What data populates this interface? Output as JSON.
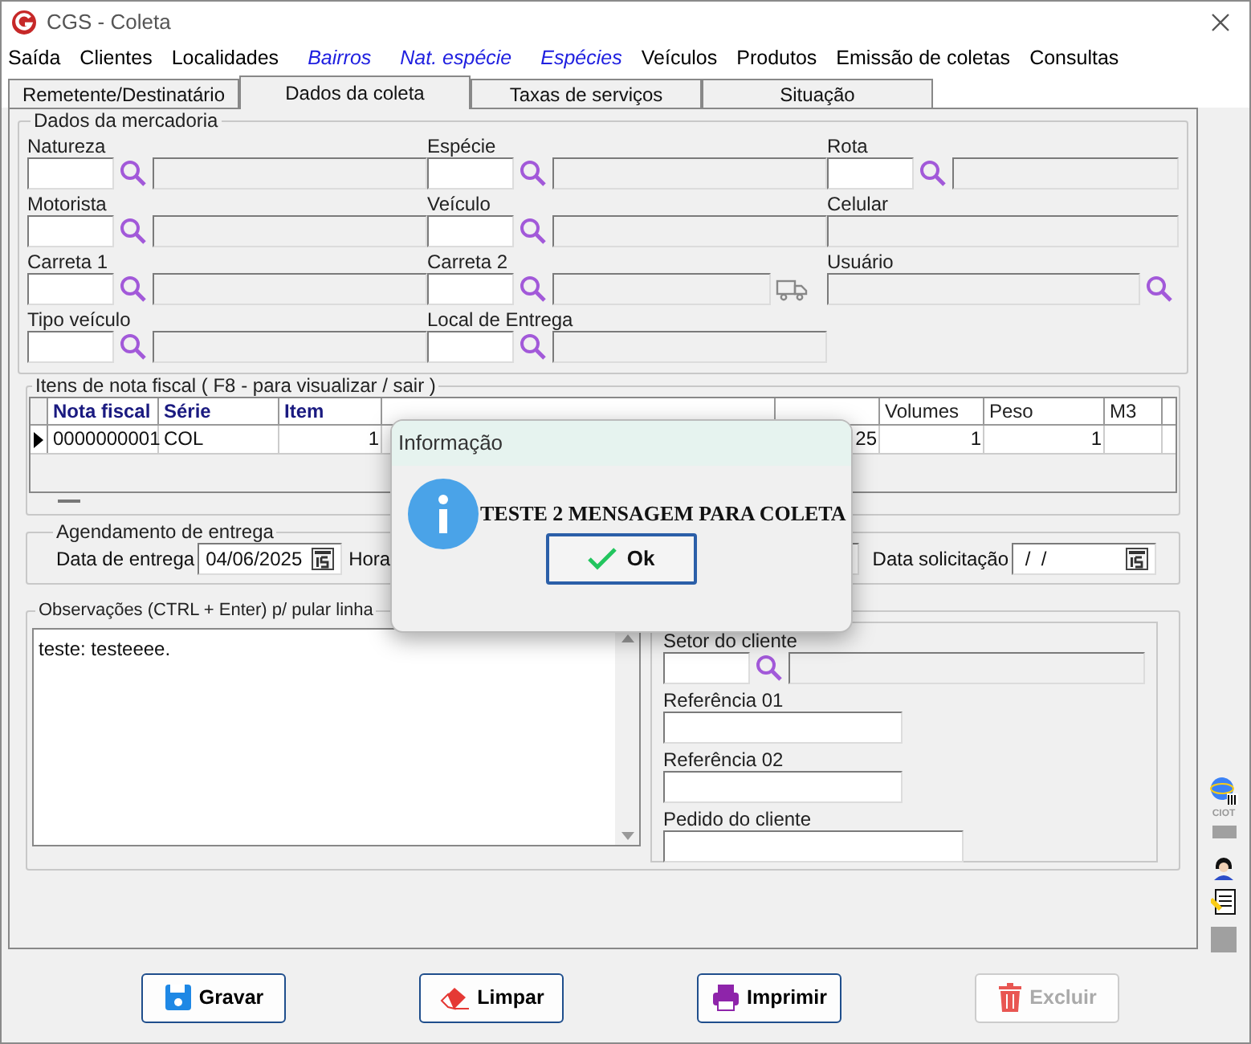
{
  "window": {
    "title": "CGS - Coleta"
  },
  "menu": [
    {
      "label": "Saída",
      "kind": "normal"
    },
    {
      "label": "Clientes",
      "kind": "normal"
    },
    {
      "label": "Localidades",
      "kind": "normal"
    },
    {
      "label": "Bairros",
      "kind": "shortcut"
    },
    {
      "label": "Nat. espécie",
      "kind": "shortcut"
    },
    {
      "label": "Espécies",
      "kind": "shortcut"
    },
    {
      "label": "Veículos",
      "kind": "normal"
    },
    {
      "label": "Produtos",
      "kind": "normal"
    },
    {
      "label": "Emissão de coletas",
      "kind": "normal"
    },
    {
      "label": "Consultas",
      "kind": "normal"
    }
  ],
  "tabs": [
    {
      "label": "Remetente/Destinatário",
      "selected": false
    },
    {
      "label": "Dados da coleta",
      "selected": true
    },
    {
      "label": "Taxas de serviços",
      "selected": false
    },
    {
      "label": "Situação",
      "selected": false
    }
  ],
  "cargo_group": {
    "title": "Dados da mercadoria",
    "rows": [
      [
        {
          "label": "Natureza",
          "kind": "lookup"
        },
        {
          "label": "Espécie",
          "kind": "lookup"
        },
        {
          "label": "Rota",
          "kind": "lookup"
        }
      ],
      [
        {
          "label": "Motorista",
          "kind": "lookup"
        },
        {
          "label": "Veículo",
          "kind": "lookup"
        },
        {
          "label": "Celular",
          "kind": "plain"
        }
      ],
      [
        {
          "label": "Carreta 1",
          "kind": "lookup"
        },
        {
          "label": "Carreta 2",
          "kind": "lookup_truck"
        },
        {
          "label": "Usuário",
          "kind": "search_after"
        }
      ],
      [
        {
          "label": "Tipo veículo",
          "kind": "lookup"
        },
        {
          "label": "Local de Entrega",
          "kind": "lookup"
        }
      ]
    ]
  },
  "items_group": {
    "title": "Itens de nota fiscal ( F8 - para visualizar / sair )",
    "columns": [
      {
        "label": "Nota fiscal",
        "kind": "key"
      },
      {
        "label": "Série",
        "kind": "key"
      },
      {
        "label": "Item",
        "kind": "key"
      },
      {
        "kind": "covered"
      },
      {
        "kind": "covered"
      },
      {
        "label": "Volumes",
        "kind": "plain"
      },
      {
        "label": "Peso",
        "kind": "plain"
      },
      {
        "label": "M3",
        "kind": "plain"
      }
    ],
    "rows": [
      {
        "current": true,
        "cells": [
          "0000000001",
          "COL",
          "1",
          "",
          "25",
          "1",
          "1",
          ""
        ]
      }
    ]
  },
  "schedule_group": {
    "title": "Agendamento de entrega",
    "fields": [
      {
        "label": "Data de entrega",
        "value": "04/06/2025",
        "kind": "date"
      },
      {
        "label": "Hora",
        "kind": "time"
      },
      {
        "label": "Data solicitação",
        "value": " /  /",
        "kind": "date"
      }
    ]
  },
  "notes_group": {
    "title": "Observações (CTRL + Enter) p/ pular linha",
    "text": "teste: testeeee.",
    "client_fields": [
      {
        "label": "Setor do cliente",
        "kind": "lookup"
      },
      {
        "label": "Referência 01",
        "kind": "half"
      },
      {
        "label": "Referência 02",
        "kind": "half"
      },
      {
        "label": "Pedido do cliente",
        "kind": "medium"
      }
    ]
  },
  "side_toolbar": {
    "label": "CIOT"
  },
  "buttons": [
    {
      "label": "Gravar",
      "kind": "save",
      "disabled": false
    },
    {
      "label": "Limpar",
      "kind": "clear",
      "disabled": false
    },
    {
      "label": "Imprimir",
      "kind": "print",
      "disabled": false
    },
    {
      "label": "Excluir",
      "kind": "delete",
      "disabled": true
    }
  ],
  "dialog": {
    "title": "Informação",
    "message": "TESTE 2 MENSAGEM PARA COLETA",
    "button": "Ok"
  }
}
